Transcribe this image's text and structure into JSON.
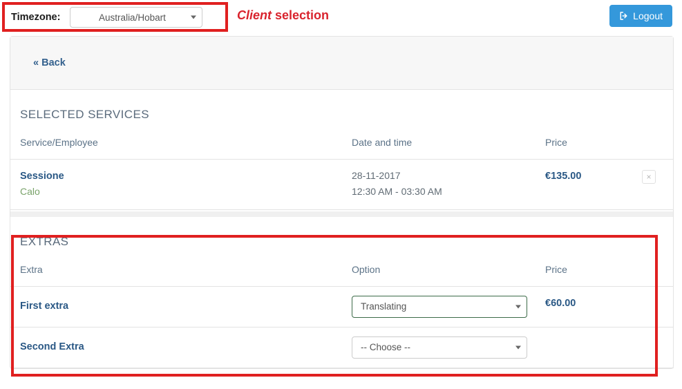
{
  "topbar": {
    "timezone_label": "Timezone:",
    "timezone_value": "Australia/Hobart",
    "client_selection_emphasis": "Client",
    "client_selection_rest": " selection",
    "logout_label": "Logout",
    "logout_icon": "sign-out-icon",
    "accent_red": "#e02020",
    "logout_blue": "#3498db"
  },
  "panel": {
    "back_label": "« Back"
  },
  "selected_services": {
    "title": "SELECTED SERVICES",
    "columns": [
      "Service/Employee",
      "Date and time",
      "Price",
      ""
    ],
    "rows": [
      {
        "service": "Sessione",
        "employee": "Calo",
        "date": "28-11-2017",
        "time": "12:30 AM - 03:30 AM",
        "price": "€135.00",
        "remove_label": "×"
      }
    ]
  },
  "extras": {
    "title": "EXTRAS",
    "columns": [
      "Extra",
      "Option",
      "Price"
    ],
    "rows": [
      {
        "name": "First extra",
        "option": "Translating",
        "price": "€60.00"
      },
      {
        "name": "Second Extra",
        "option": "-- Choose --",
        "price": ""
      }
    ]
  }
}
